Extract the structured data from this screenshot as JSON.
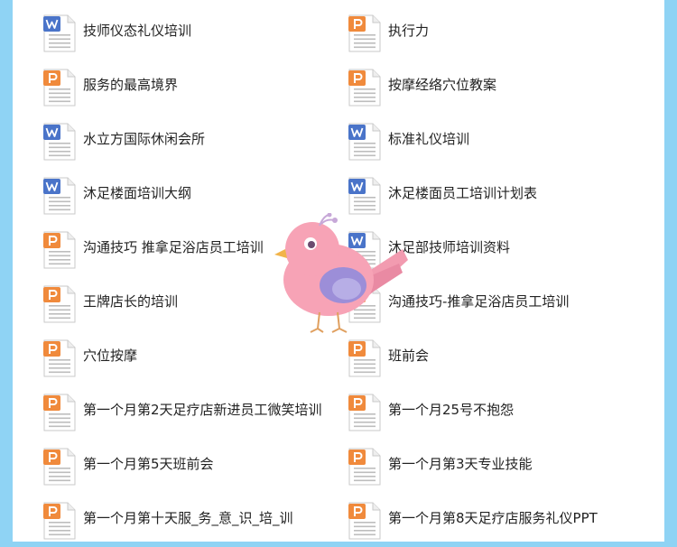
{
  "colors": {
    "background": "#8fd3f4",
    "panel": "#ffffff",
    "word_icon": "#4a74c9",
    "ppt_icon": "#f08a3c",
    "text": "#222222"
  },
  "files": [
    {
      "label": "技师仪态礼仪培训",
      "icon": "word-doc-icon"
    },
    {
      "label": "执行力",
      "icon": "ppt-doc-icon"
    },
    {
      "label": "服务的最高境界",
      "icon": "ppt-doc-icon"
    },
    {
      "label": "按摩经络穴位教案",
      "icon": "ppt-doc-icon"
    },
    {
      "label": "水立方国际休闲会所",
      "icon": "word-doc-icon"
    },
    {
      "label": "标准礼仪培训",
      "icon": "word-doc-icon"
    },
    {
      "label": "沐足楼面培训大纲",
      "icon": "word-doc-icon"
    },
    {
      "label": "沐足楼面员工培训计划表",
      "icon": "word-doc-icon"
    },
    {
      "label": "沟通技巧 推拿足浴店员工培训",
      "icon": "ppt-doc-icon"
    },
    {
      "label": "沐足部技师培训资料",
      "icon": "word-doc-icon"
    },
    {
      "label": "王牌店长的培训",
      "icon": "ppt-doc-icon"
    },
    {
      "label": "沟通技巧-推拿足浴店员工培训",
      "icon": "ppt-doc-icon"
    },
    {
      "label": "穴位按摩",
      "icon": "ppt-doc-icon"
    },
    {
      "label": "班前会",
      "icon": "ppt-doc-icon"
    },
    {
      "label": "第一个月第2天足疗店新进员工微笑培训",
      "icon": "ppt-doc-icon"
    },
    {
      "label": "第一个月25号不抱怨",
      "icon": "ppt-doc-icon"
    },
    {
      "label": "第一个月第5天班前会",
      "icon": "ppt-doc-icon"
    },
    {
      "label": "第一个月第3天专业技能",
      "icon": "ppt-doc-icon"
    },
    {
      "label": "第一个月第十天服_务_意_识_培_训",
      "icon": "ppt-doc-icon"
    },
    {
      "label": "第一个月第8天足疗店服务礼仪PPT",
      "icon": "ppt-doc-icon"
    }
  ]
}
